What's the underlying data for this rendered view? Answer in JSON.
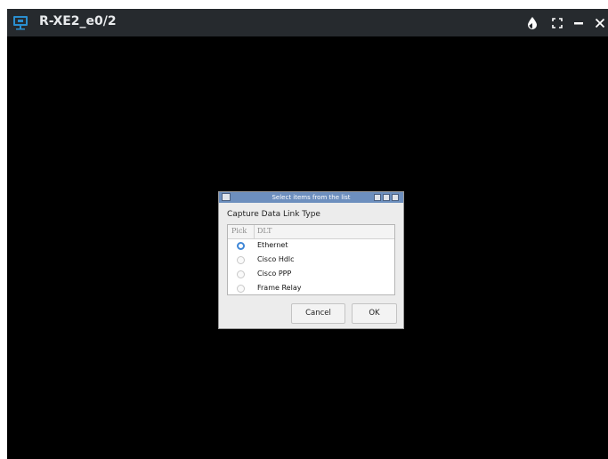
{
  "window": {
    "title": "R-XE2_e0/2",
    "app_icon": "monitor-icon",
    "controls": [
      "contrast-icon",
      "fullscreen-icon",
      "minimize-icon",
      "close-icon"
    ],
    "colors": {
      "titlebar": "#262a2e",
      "background": "#000000",
      "icon_accent": "#2a8fd0"
    }
  },
  "dialog": {
    "title": "Select items from the list",
    "label": "Capture Data Link Type",
    "columns": {
      "pick": "Pick",
      "dlt": "DLT"
    },
    "options": [
      {
        "label": "Ethernet",
        "selected": true
      },
      {
        "label": "Cisco Hdlc",
        "selected": false
      },
      {
        "label": "Cisco PPP",
        "selected": false
      },
      {
        "label": "Frame Relay",
        "selected": false
      }
    ],
    "cancel_label": "Cancel",
    "ok_label": "OK",
    "colors": {
      "titlebar": "#6d8fbe",
      "selected_radio": "#3f87d7"
    }
  }
}
